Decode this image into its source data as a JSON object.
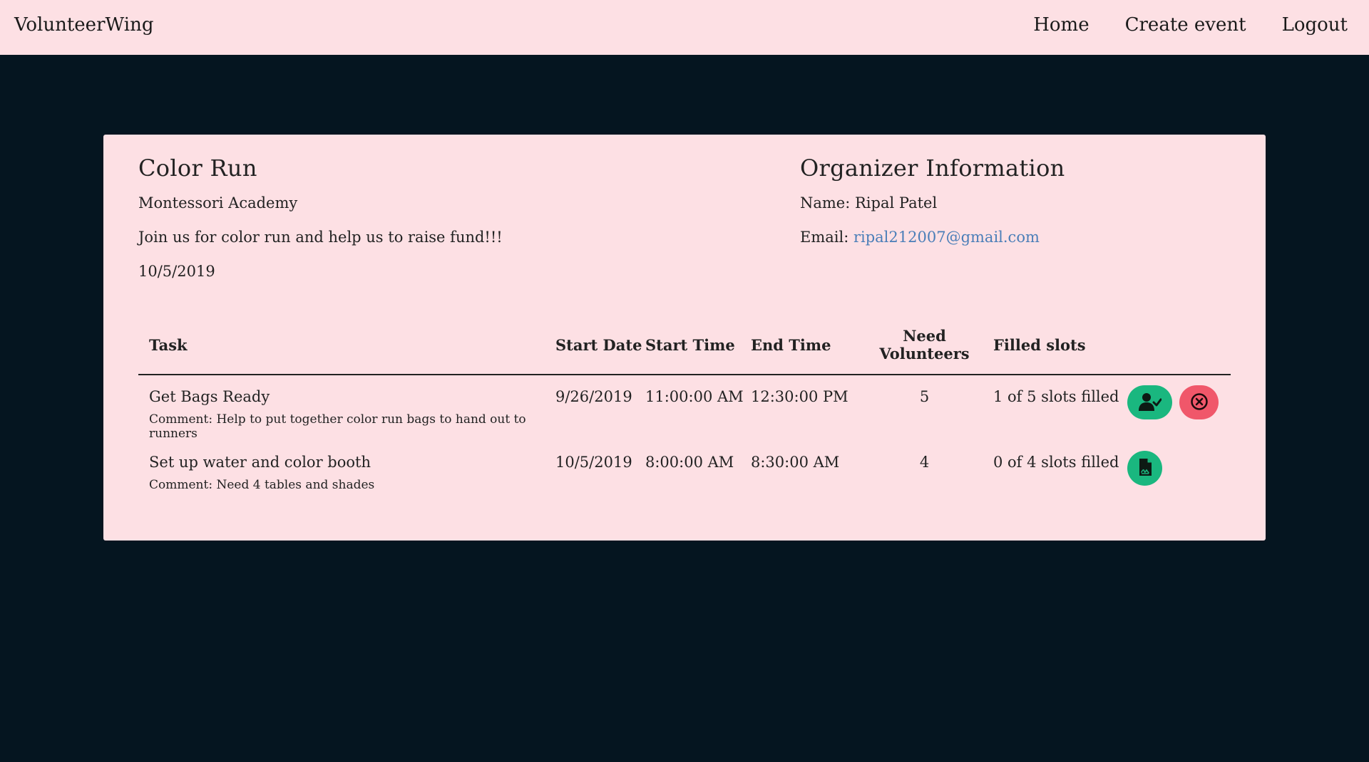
{
  "nav": {
    "brand": "VolunteerWing",
    "links": [
      "Home",
      "Create event",
      "Logout"
    ]
  },
  "event": {
    "title": "Color Run",
    "location": "Montessori Academy",
    "description": "Join us for color run and help us to raise fund!!!",
    "date": "10/5/2019"
  },
  "organizer": {
    "heading": "Organizer Information",
    "name_label": "Name:",
    "name": "Ripal Patel",
    "email_label": "Email:",
    "email": "ripal212007@gmail.com"
  },
  "table": {
    "headers": [
      "Task",
      "Start Date",
      "Start Time",
      "End Time",
      "Need Volunteers",
      "Filled slots"
    ],
    "rows": [
      {
        "task": "Get Bags Ready",
        "comment": "Comment: Help to put together color run bags to hand out to runners",
        "start_date": "9/26/2019",
        "start_time": "11:00:00 AM",
        "end_time": "12:30:00 PM",
        "need": "5",
        "filled": "1 of 5 slots filled",
        "actions": [
          "user-check-icon",
          "cancel-circle-icon"
        ]
      },
      {
        "task": "Set up water and color booth",
        "comment": "Comment: Need 4 tables and shades",
        "start_date": "10/5/2019",
        "start_time": "8:00:00 AM",
        "end_time": "8:30:00 AM",
        "need": "4",
        "filled": "0 of 4 slots filled",
        "actions": [
          "signup-document-icon"
        ]
      }
    ]
  },
  "colors": {
    "background": "#051520",
    "card": "#fde0e4",
    "green": "#1ab77f",
    "red": "#f0576a",
    "link": "#4a7eb8"
  }
}
